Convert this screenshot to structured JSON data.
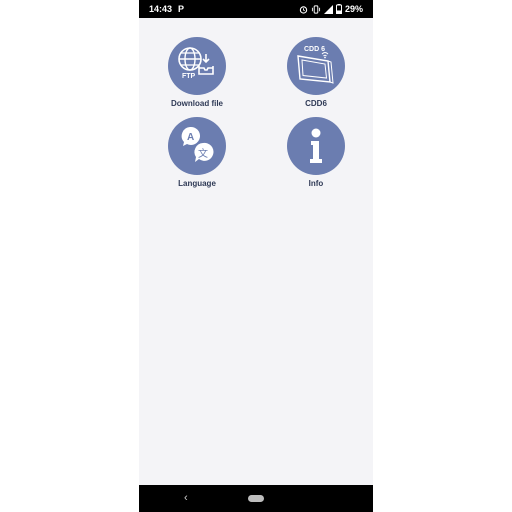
{
  "status_bar": {
    "time": "14:43",
    "app_indicator": "P",
    "battery": "29%",
    "icons": [
      "alarm-icon",
      "vibrate-icon",
      "signal-icon",
      "battery-icon"
    ]
  },
  "menu": {
    "items": [
      {
        "label": "Download file",
        "icon": "ftp-download-icon"
      },
      {
        "label": "CDD6",
        "icon": "cdd6-device-icon",
        "icon_text": "CDD 6"
      },
      {
        "label": "Language",
        "icon": "language-icon",
        "icon_text_a": "A",
        "icon_text_b": "文"
      },
      {
        "label": "Info",
        "icon": "info-icon"
      }
    ],
    "ftp_text": "FTP"
  },
  "nav_bar": {
    "back_glyph": "‹"
  },
  "colors": {
    "icon_circle": "#6b7db0",
    "label_text": "#2f3a56",
    "background": "#f4f4f7"
  }
}
